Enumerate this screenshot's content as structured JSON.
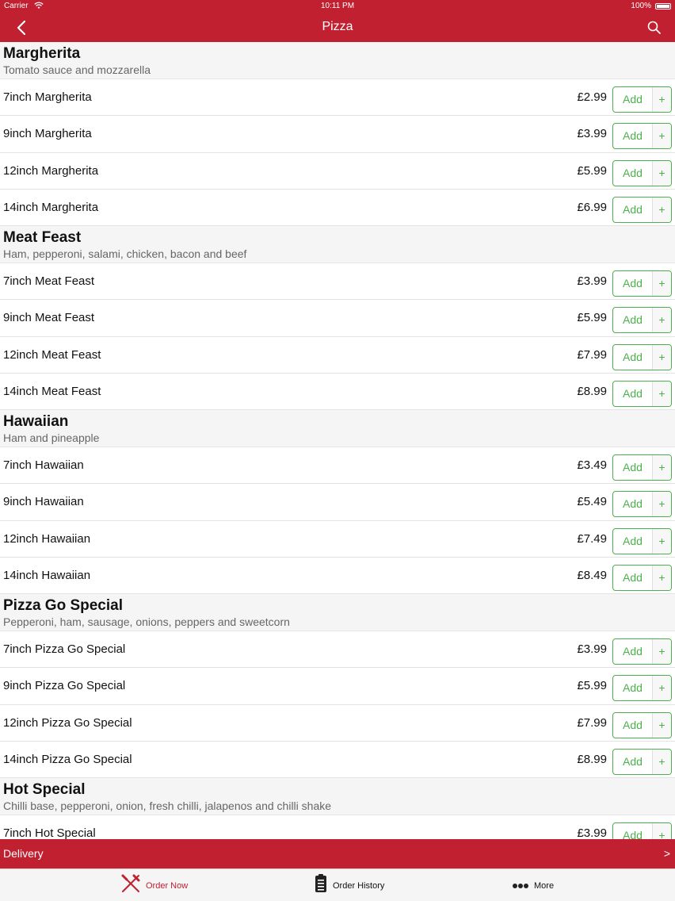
{
  "status_bar": {
    "carrier": "Carrier",
    "time": "10:11 PM",
    "battery": "100%"
  },
  "nav": {
    "title": "Pizza"
  },
  "colors": {
    "brand_red": "#c0202f",
    "add_green": "#4cb04c"
  },
  "icons": {
    "back": "chevron-left-icon",
    "search": "search-icon",
    "order_now": "fork-knife-icon",
    "order_history": "clipboard-icon",
    "more": "ellipsis-icon"
  },
  "add_button": {
    "label": "Add",
    "plus": "+"
  },
  "sections": [
    {
      "title": "Margherita",
      "desc": "Tomato sauce and mozzarella",
      "items": [
        {
          "name": "7inch Margherita",
          "price": "£2.99"
        },
        {
          "name": "9inch Margherita",
          "price": "£3.99"
        },
        {
          "name": "12inch Margherita",
          "price": "£5.99"
        },
        {
          "name": "14inch Margherita",
          "price": "£6.99"
        }
      ]
    },
    {
      "title": "Meat Feast",
      "desc": "Ham, pepperoni, salami, chicken, bacon and beef",
      "items": [
        {
          "name": "7inch Meat Feast",
          "price": "£3.99"
        },
        {
          "name": "9inch Meat Feast",
          "price": "£5.99"
        },
        {
          "name": "12inch Meat Feast",
          "price": "£7.99"
        },
        {
          "name": "14inch Meat Feast",
          "price": "£8.99"
        }
      ]
    },
    {
      "title": "Hawaiian",
      "desc": "Ham and pineapple",
      "items": [
        {
          "name": "7inch Hawaiian",
          "price": "£3.49"
        },
        {
          "name": "9inch Hawaiian",
          "price": "£5.49"
        },
        {
          "name": "12inch Hawaiian",
          "price": "£7.49"
        },
        {
          "name": "14inch Hawaiian",
          "price": "£8.49"
        }
      ]
    },
    {
      "title": "Pizza Go Special",
      "desc": "Pepperoni, ham, sausage, onions, peppers and sweetcorn",
      "items": [
        {
          "name": "7inch Pizza Go Special",
          "price": "£3.99"
        },
        {
          "name": "9inch Pizza Go Special",
          "price": "£5.99"
        },
        {
          "name": "12inch Pizza Go Special",
          "price": "£7.99"
        },
        {
          "name": "14inch Pizza Go Special",
          "price": "£8.99"
        }
      ]
    },
    {
      "title": "Hot Special",
      "desc": "Chilli base, pepperoni, onion, fresh chilli, jalapenos and chilli shake",
      "items": [
        {
          "name": "7inch Hot Special",
          "price": "£3.99"
        }
      ]
    }
  ],
  "delivery": {
    "label": "Delivery",
    "arrow": ">"
  },
  "tabs": {
    "order_now": "Order Now",
    "order_history": "Order History",
    "more": "More"
  }
}
